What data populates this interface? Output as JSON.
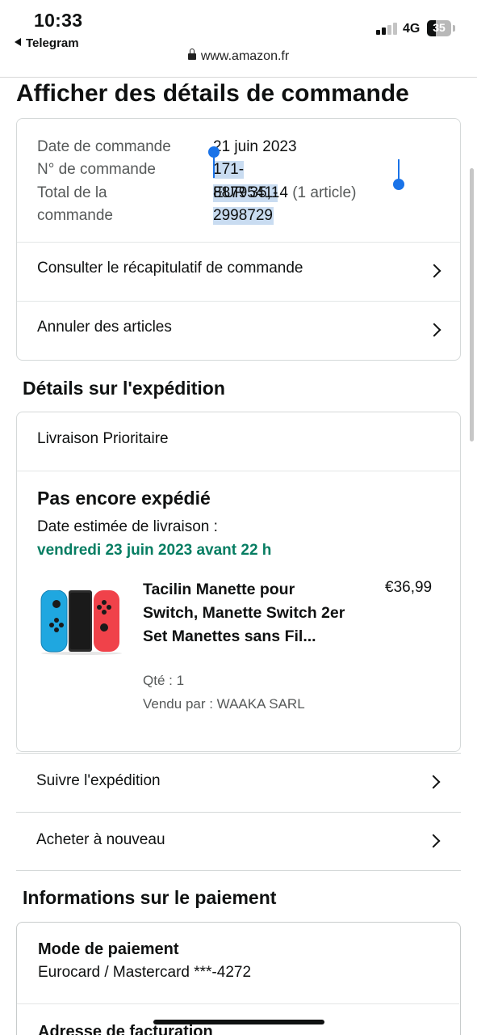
{
  "status_bar": {
    "time": "10:33",
    "back_app": "Telegram",
    "network": "4G",
    "battery": "35",
    "battery_level_percent": 35,
    "url": "www.amazon.fr"
  },
  "page": {
    "title": "Afficher des détails de commande"
  },
  "order": {
    "date_label": "Date de commande",
    "date_value": "21 juin 2023",
    "number_label": "N° de commande",
    "number_value": "171-8879541-2998729",
    "total_label_line1": "Total de la",
    "total_label_line2": "commande",
    "total_value": "EUR 35,14",
    "total_items": "(1 article)",
    "links": {
      "summary": "Consulter le récapitulatif de commande",
      "cancel": "Annuler des articles"
    }
  },
  "shipping": {
    "section_title": "Détails sur l'expédition",
    "type": "Livraison Prioritaire",
    "status": "Pas encore expédié",
    "delivery_label": "Date estimée de livraison :",
    "delivery_date": "vendredi 23 juin 2023 avant 22 h",
    "product": {
      "name": "Tacilin Manette pour Switch, Manette Switch 2er Set Manettes sans Fil...",
      "price": "€36,99",
      "qty": "Qté : 1",
      "seller": "Vendu par : WAAKA SARL"
    },
    "actions": {
      "track": "Suivre l'expédition",
      "buy_again": "Acheter à nouveau"
    }
  },
  "payment": {
    "section_title": "Informations sur le paiement",
    "method_label": "Mode de paiement",
    "method_value": "Eurocard / Mastercard ***-4272",
    "billing_label": "Adresse de facturation"
  },
  "colors": {
    "green": "#067d62",
    "selection": "#c9dcf1",
    "cursor": "#1a73e8",
    "border": "#d5d9d9",
    "joycon_left": "#1fa7e0",
    "joycon_right": "#f0424a"
  }
}
